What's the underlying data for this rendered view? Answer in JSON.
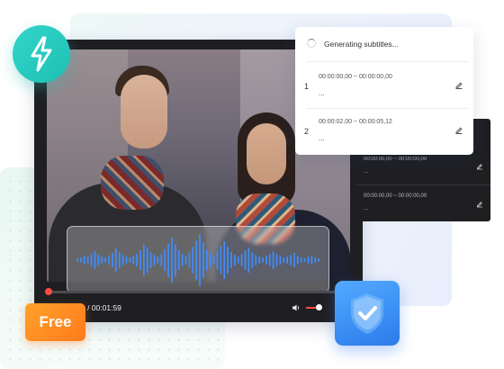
{
  "badges": {
    "free_label": "Free",
    "bolt_icon": "lightning-bolt-icon",
    "shield_icon": "shield-check-icon"
  },
  "player": {
    "time_display": "0 / 00:01:59",
    "progress_percent": 0,
    "volume_icon": "speaker-icon"
  },
  "subtitle_panel": {
    "status_text": "Generating subtitles...",
    "rows": [
      {
        "number": "1",
        "timecode": "00:00:00,00 ~ 00:00:00,00",
        "text": "..."
      },
      {
        "number": "2",
        "timecode": "00:00:02,00 ~ 00:00:05,12",
        "text": "..."
      }
    ]
  },
  "subtitle_panel_back": {
    "rows": [
      {
        "timecode": "00:00:00,00 ~ 00:00:00,00",
        "text": "..."
      },
      {
        "timecode": "00:00:00,00 ~ 00:00:00,00",
        "text": "..."
      }
    ]
  },
  "colors": {
    "accent_orange": "#ff8a1f",
    "accent_teal": "#27cbbf",
    "accent_blue": "#3b8df5",
    "waveform_blue": "#3f8dff",
    "progress_red": "#ff4a3f"
  }
}
